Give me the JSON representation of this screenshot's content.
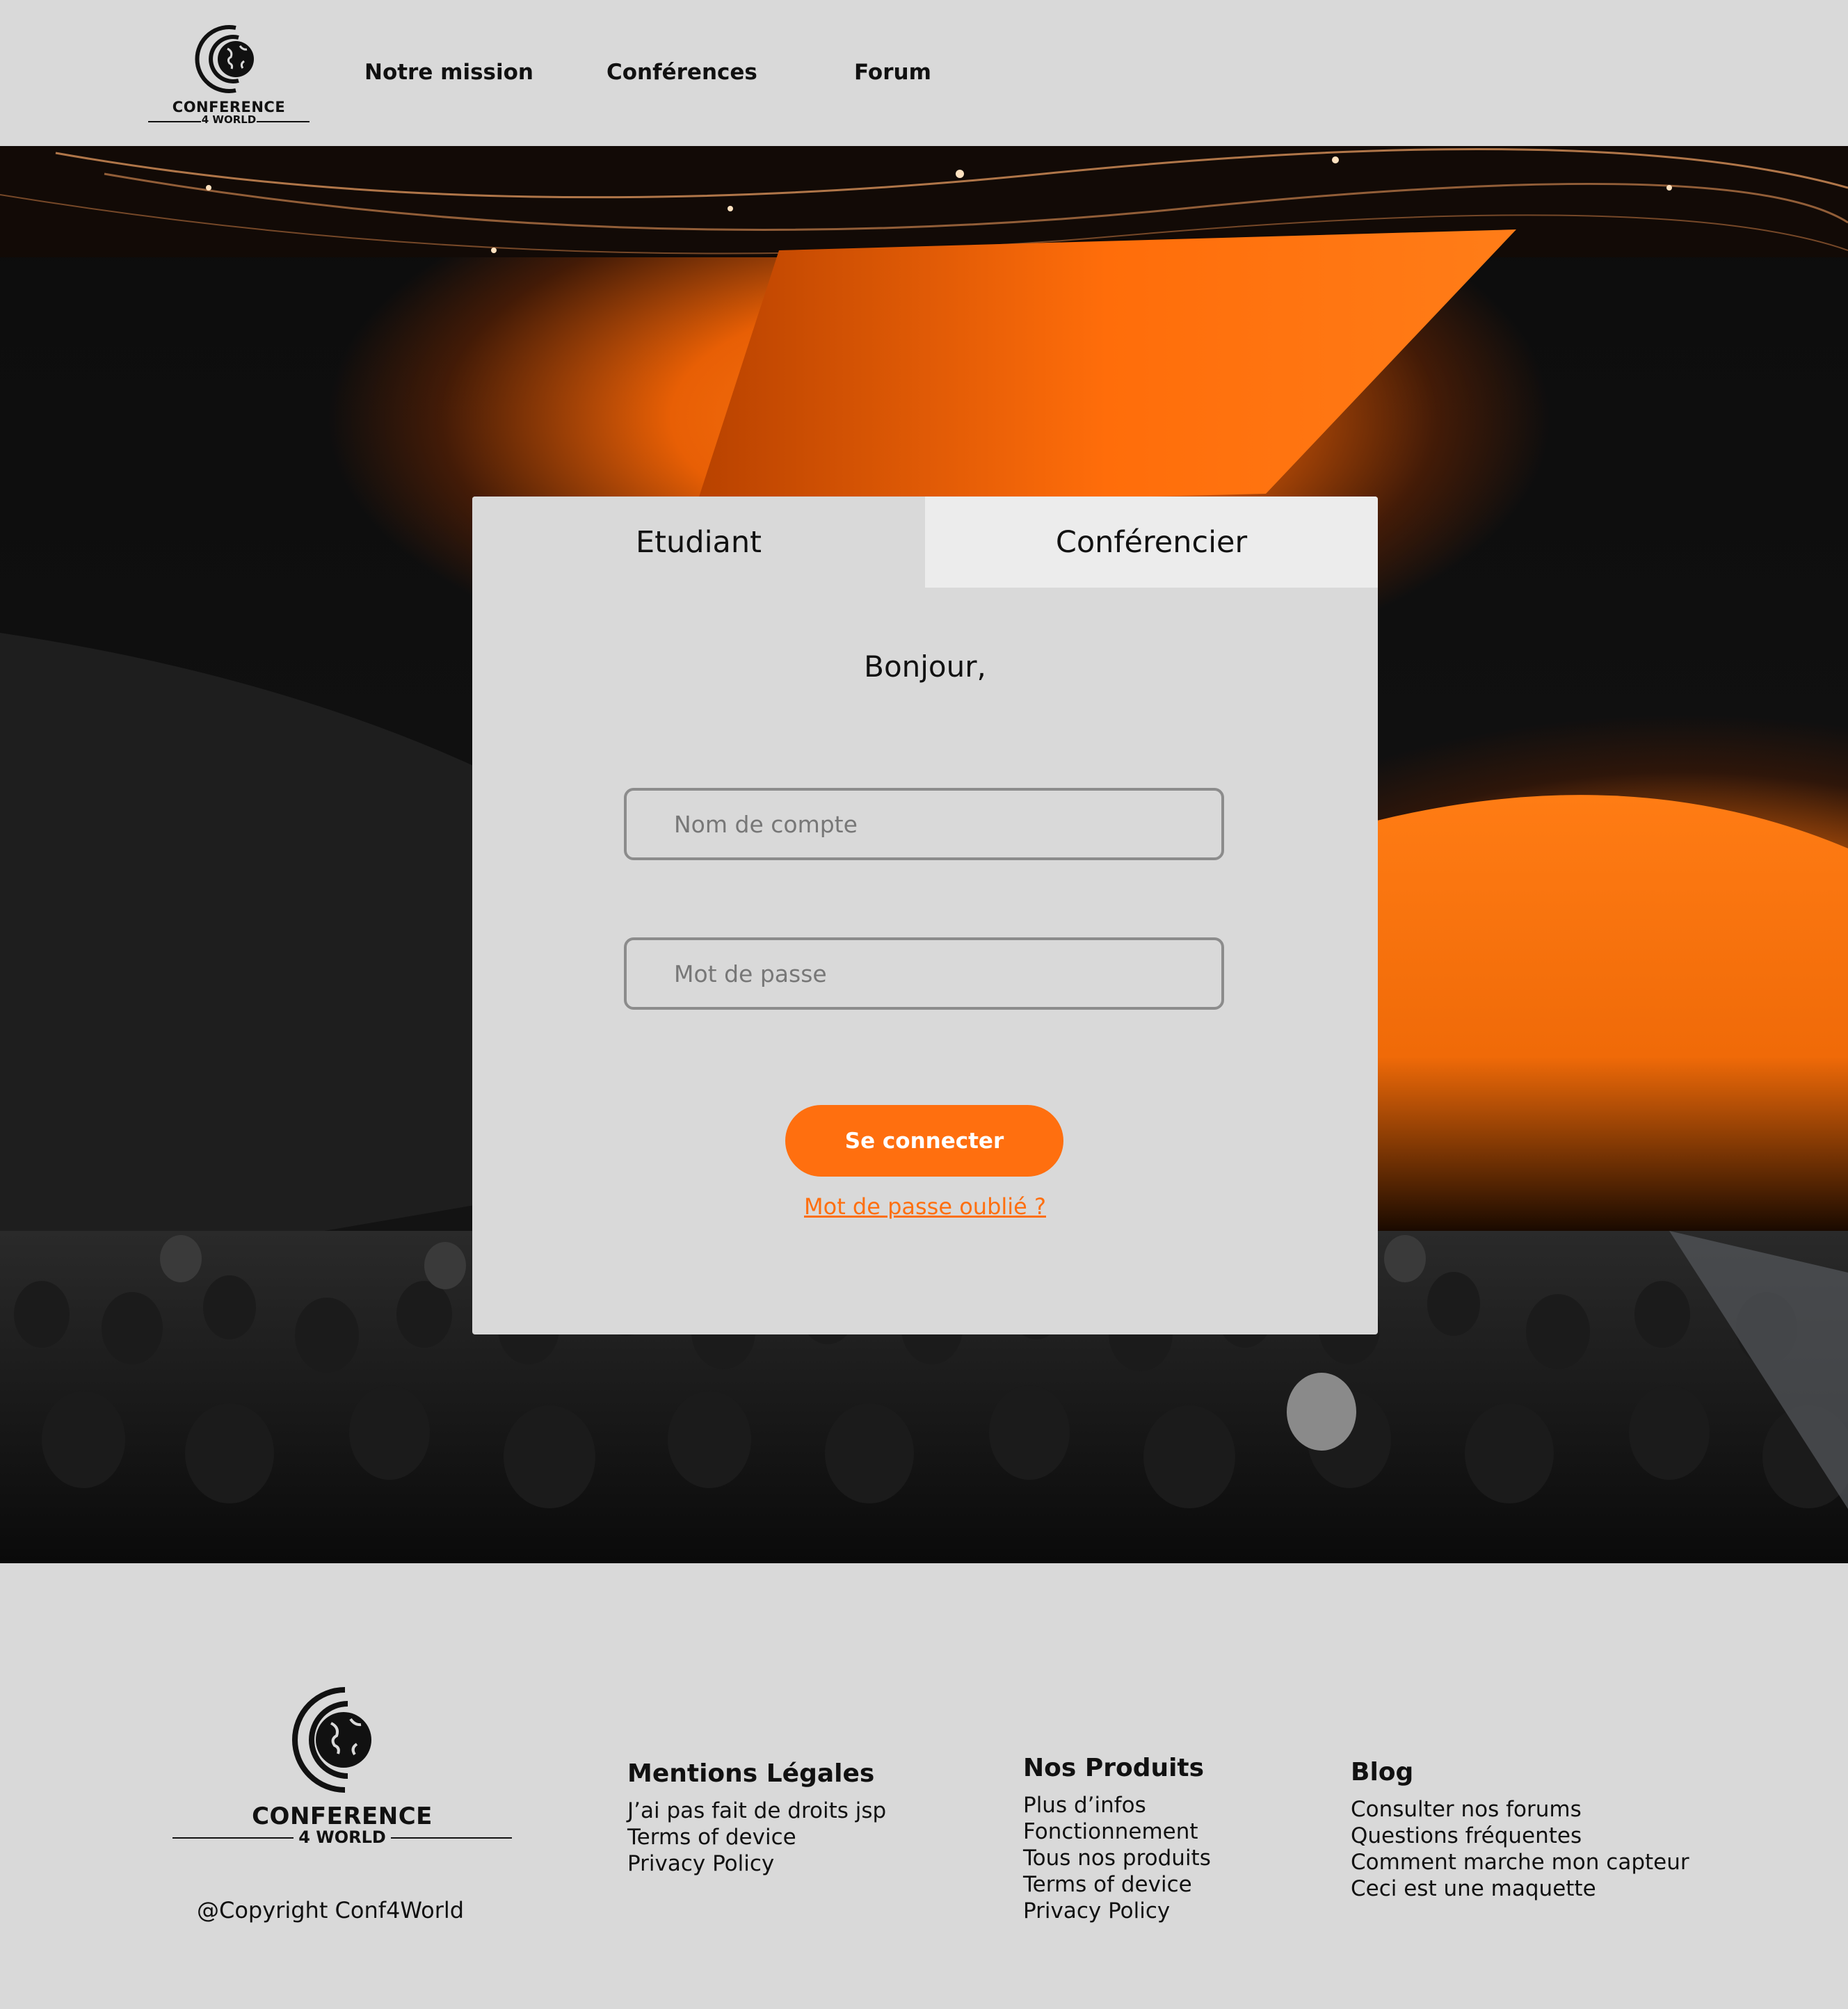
{
  "header": {
    "logo": {
      "word": "CONFERENCE",
      "sub": "4 WORLD"
    },
    "nav": [
      "Notre mission",
      "Conférences",
      "Forum"
    ]
  },
  "login": {
    "tabs": [
      "Etudiant",
      "Conférencier"
    ],
    "greeting": "Bonjour,",
    "username_placeholder": "Nom de compte",
    "password_placeholder": "Mot de passe",
    "submit_label": "Se connecter",
    "forgot_label": "Mot de passe oublié ?"
  },
  "footer": {
    "logo": {
      "word": "CONFERENCE",
      "sub": "4 WORLD"
    },
    "copyright": "@Copyright Conf4World",
    "columns": [
      {
        "title": "Mentions Légales",
        "links": [
          "J’ai pas fait de droits jsp",
          "Terms of device",
          "Privacy Policy"
        ]
      },
      {
        "title": "Nos Produits",
        "links": [
          "Plus d’infos",
          "Fonctionnement",
          "Tous nos produits",
          "Terms of device",
          "Privacy Policy"
        ]
      },
      {
        "title": "Blog",
        "links": [
          "Consulter nos forums",
          "Questions fréquentes",
          "Comment marche mon capteur",
          "Ceci est une maquette"
        ]
      }
    ]
  },
  "colors": {
    "accent": "#ff6f0f",
    "background": "#d9d9d9",
    "tab_inactive": "#ececec"
  }
}
